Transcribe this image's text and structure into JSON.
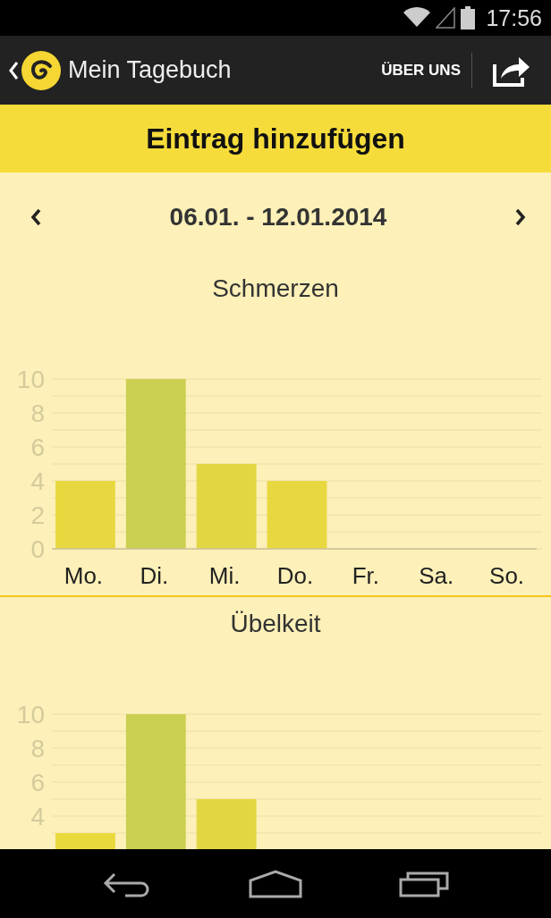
{
  "status_bar": {
    "time": "17:56"
  },
  "action_bar": {
    "title": "Mein Tagebuch",
    "actions": [
      {
        "label": "ÜBER UNS"
      }
    ]
  },
  "header": {
    "title": "Eintrag hinzufügen"
  },
  "week": {
    "range": "06.01. - 12.01.2014"
  },
  "charts": [
    {
      "chart_data": {
        "type": "bar",
        "title": "Schmerzen",
        "categories": [
          "Mo.",
          "Di.",
          "Mi.",
          "Do.",
          "Fr.",
          "Sa.",
          "So."
        ],
        "values": [
          4,
          10,
          5,
          4,
          0,
          0,
          0
        ],
        "colors": [
          "#e8d840",
          "#cbcf52",
          "#e2d742",
          "#e8d840",
          null,
          null,
          null
        ],
        "ylim": [
          0,
          10
        ],
        "yticks": [
          0,
          2,
          4,
          6,
          8,
          10
        ],
        "grid": true
      }
    },
    {
      "chart_data": {
        "type": "bar",
        "title": "Übelkeit",
        "values": [
          3,
          10,
          5,
          null,
          null,
          null,
          null
        ],
        "colors": [
          "#ead93c",
          "#cbcf52",
          "#e2d742",
          null,
          null,
          null,
          null
        ],
        "ylim": [
          0,
          10
        ],
        "yticks": [
          4,
          6,
          8,
          10
        ],
        "grid": true
      }
    }
  ]
}
